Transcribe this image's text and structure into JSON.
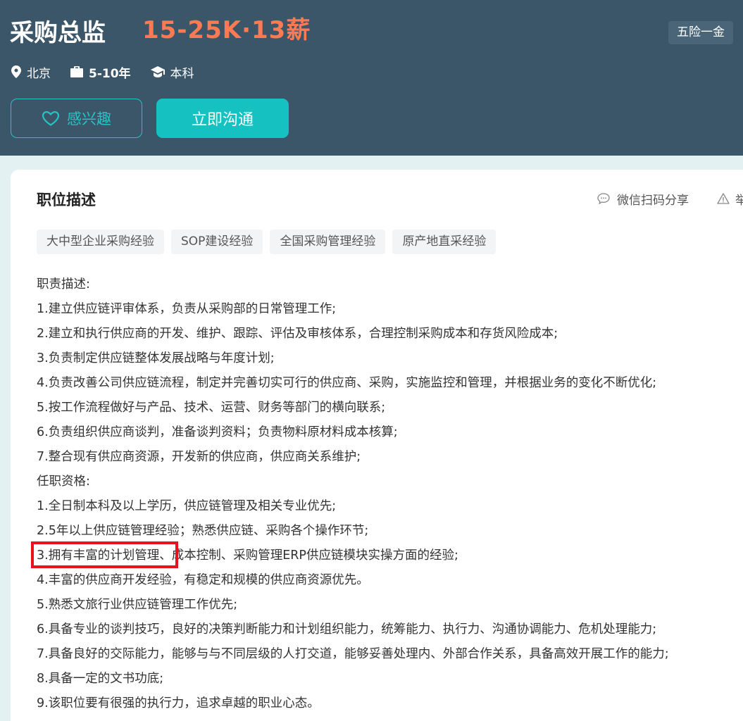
{
  "job": {
    "title": "采购总监",
    "salary": "15-25K·13薪",
    "benefit": "五险一金",
    "city": "北京",
    "experience": "5-10年",
    "education": "本科"
  },
  "actions": {
    "interest_label": "感兴趣",
    "chat_label": "立即沟通"
  },
  "detail": {
    "section_title": "职位描述",
    "share_label": "微信扫码分享",
    "report_label": "举",
    "skill_tags": [
      "大中型企业采购经验",
      "SOP建设经验",
      "全国采购管理经验",
      "原产地直采经验"
    ],
    "lines": [
      "职责描述:",
      "1.建立供应链评审体系，负责从采购部的日常管理工作;",
      "2.建立和执行供应商的开发、维护、跟踪、评估及审核体系，合理控制采购成本和存货风险成本;",
      "3.负责制定供应链整体发展战略与年度计划;",
      "4.负责改善公司供应链流程，制定并完善切实可行的供应商、采购，实施监控和管理，并根据业务的变化不断优化;",
      "5.按工作流程做好与产品、技术、运营、财务等部门的横向联系;",
      "6.负责组织供应商谈判，准备谈判资料；负责物料原材料成本核算;",
      "7.整合现有供应商资源，开发新的供应商，供应商关系维护;",
      "任职资格:",
      "1.全日制本科及以上学历，供应链管理及相关专业优先;",
      "2.5年以上供应链管理经验；熟悉供应链、采购各个操作环节;",
      "3.拥有丰富的计划管理、成本控制、采购管理ERP供应链模块实操方面的经验;",
      "4.丰富的供应商开发经验，有稳定和规模的供应商资源优先。",
      "5.熟悉文旅行业供应链管理工作优先;",
      "6.具备专业的谈判技巧，良好的决策判断能力和计划组织能力，统筹能力、执行力、沟通协调能力、危机处理能力;",
      "7.具备良好的交际能力，能够与与不同层级的人打交道，能够妥善处理内、外部合作关系，具备高效开展工作的能力;",
      "8.具备一定的文书功底;",
      "9.该职位要有很强的执行力，追求卓越的职业心态。"
    ]
  },
  "colors": {
    "header_bg": "#3b5669",
    "salary": "#ff7a52",
    "accent": "#16c1c1",
    "highlight": "#e8121c"
  },
  "icons": [
    "location-pin-icon",
    "briefcase-icon",
    "graduation-cap-icon",
    "heart-icon",
    "chat-bubble-icon",
    "warning-icon"
  ]
}
